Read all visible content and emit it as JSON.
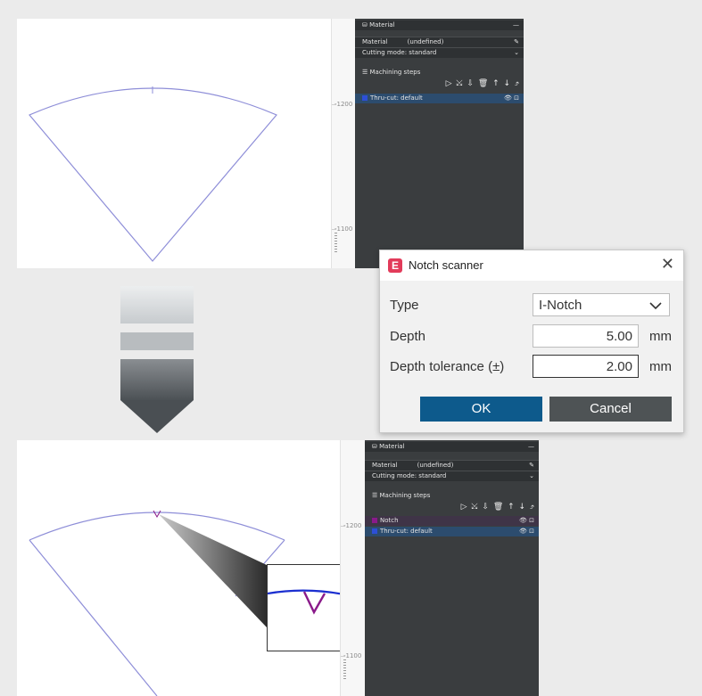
{
  "top_view": {
    "ruler_labels": [
      "-1200",
      "-1100"
    ],
    "panel": {
      "material_header": "Material",
      "material_label": "Material",
      "material_value": "(undefined)",
      "cutting_mode": "Cutting mode: standard",
      "steps_header": "Machining steps",
      "toolbar": "▷ ⤩ ⇩ 🗑 ↑ ↓ ⤴",
      "steps": [
        {
          "name": "Thru-cut: default",
          "color": "#2d4fd6"
        }
      ]
    }
  },
  "dialog": {
    "title": "Notch scanner",
    "close": "✕",
    "type_label": "Type",
    "type_value": "I-Notch",
    "depth_label": "Depth",
    "depth_value": "5.00",
    "depth_unit": "mm",
    "tolerance_label": "Depth tolerance (±)",
    "tolerance_value": "2.00",
    "tolerance_unit": "mm",
    "ok": "OK",
    "cancel": "Cancel",
    "colors": {
      "ok": "#0d5a8c",
      "cancel": "#4e5355"
    }
  },
  "bottom_view": {
    "ruler_labels": [
      "-1200",
      "-1100"
    ],
    "panel": {
      "material_header": "Material",
      "material_label": "Material",
      "material_value": "(undefined)",
      "cutting_mode": "Cutting mode: standard",
      "steps_header": "Machining steps",
      "toolbar": "▷ ⤩ ⇩ 🗑 ↑ ↓ ⤴",
      "steps": [
        {
          "name": "Notch",
          "color": "#8a1a8a"
        },
        {
          "name": "Thru-cut: default",
          "color": "#2d4fd6"
        }
      ]
    }
  },
  "colors": {
    "contour": "#8e8ed8",
    "zoom_line": "#1b2fd0",
    "notch": "#8a1a8a",
    "panel_bg": "#3a3d3f"
  }
}
